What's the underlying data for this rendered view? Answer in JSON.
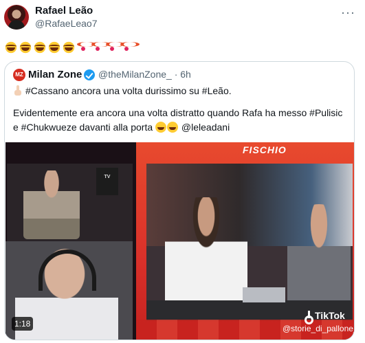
{
  "author": {
    "display_name": "Rafael Leão",
    "handle": "@RafaeLeao7"
  },
  "more_label": "···",
  "tweet_emojis": [
    "laugh",
    "laugh",
    "laugh",
    "laugh",
    "laugh",
    "clown",
    "clown",
    "clown",
    "clown"
  ],
  "quoted": {
    "logo_text": "MZ",
    "display_name": "Milan Zone",
    "handle_time": "@theMilanZone_ · 6h",
    "line1": "#Cassano ancora una volta durissimo su #Leão.",
    "line2": "Evidentemente era ancora una volta distratto quando Rafa ha messo #Pulisic",
    "line3_prefix": "e #Chukwueze davanti alla porta",
    "line3_suffix": "@leleadani"
  },
  "video": {
    "banner_text": "FISCHIO",
    "sign_text": "TV",
    "duration": "1:18",
    "watermark": "TikTok",
    "watermark_handle": "@storie_di_pallone_"
  },
  "colors": {
    "link": "#1d9bf0",
    "text": "#0f1419",
    "muted": "#536471",
    "verified": "#1d9bf0",
    "accent_red": "#d9302a"
  }
}
